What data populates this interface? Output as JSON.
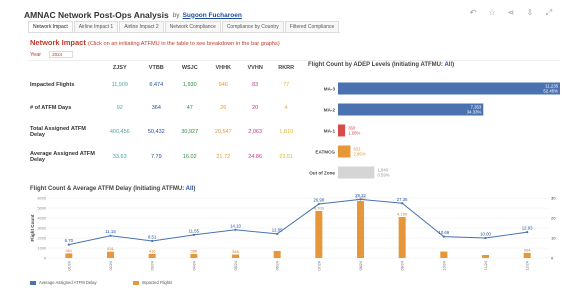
{
  "header": {
    "title": "AMNAC Network Post-Ops Analysis",
    "by": "by",
    "author": "Sugoon Fucharoen",
    "icons": [
      "undo-icon",
      "star-icon",
      "share-icon",
      "download-icon",
      "expand-icon"
    ]
  },
  "tabs": [
    "Network Impact",
    "Airline Impact 1",
    "Airline Impact 2",
    "Network Compliance",
    "Compliance by Country",
    "Filtered Compliance"
  ],
  "section": {
    "title": "Network Impact",
    "note": "(Click on an initiating ATFMU in the table to see breakdown in the bar graphs)",
    "year_label": "Year",
    "year_value": "2024"
  },
  "metrics_table": {
    "columns": [
      "ZJSY",
      "VTBB",
      "WSJC",
      "VHHK",
      "VVHN",
      "RKRR"
    ],
    "column_colors": [
      "#4fa3a5",
      "#1f4e9c",
      "#2e8b3e",
      "#e8963a",
      "#c0398b",
      "#e0b52a"
    ],
    "rows": [
      {
        "label": "Impacted Flights",
        "values": [
          "11,909",
          "6,474",
          "1,930",
          "946",
          "83",
          "77"
        ]
      },
      {
        "label": "# of ATFM Days",
        "values": [
          "92",
          "364",
          "47",
          "26",
          "20",
          "4"
        ]
      },
      {
        "label": "Total Assigned ATFM Delay",
        "values": [
          "400,456",
          "50,432",
          "30,927",
          "20,547",
          "2,063",
          "1,810"
        ]
      },
      {
        "label": "Average Assigned ATFM Delay",
        "values": [
          "33.63",
          "7.79",
          "16.02",
          "21.72",
          "24.86",
          "23.51"
        ]
      }
    ]
  },
  "adep_chart": {
    "title_prefix": "Flight Count by ADEP Levels (Initiating ATFMU:",
    "title_filter": "All",
    "title_suffix": ")",
    "chart_data": {
      "type": "bar",
      "categories": [
        "MA-3",
        "MA-2",
        "MA-1",
        "EATMCG",
        "Out of Zone"
      ],
      "values": [
        11235,
        7353,
        360,
        631,
        1840
      ],
      "value_labels": [
        "11,235",
        "7,353",
        "360",
        "631",
        "1,840"
      ],
      "percent_labels": [
        "52.45%",
        "34.33%",
        "1.68%",
        "2.95%",
        "8.59%"
      ],
      "colors": [
        "#4a72b0",
        "#4a72b0",
        "#d94b4b",
        "#e8963a",
        "#d5d5d5"
      ]
    }
  },
  "combo_chart": {
    "title_prefix": "Flight Count & Average ATFM Delay (Initiating ATFMU:",
    "title_filter": "All",
    "title_suffix": ")",
    "chart_data": {
      "type": "bar",
      "categories": [
        "01/24",
        "02/24",
        "03/24",
        "04/24",
        "05/24",
        "06/24",
        "07/24",
        "08/24",
        "09/24",
        "10/24",
        "11/24",
        "12/24"
      ],
      "x_labels": [
        "01/24",
        "02/24",
        "03/24",
        "04/24",
        "05/24",
        "06/24",
        "07/24",
        "08/24",
        "09/24",
        "10/24",
        "11/24",
        "12/24"
      ],
      "ylabel": "Flight Count",
      "ylim": [
        0,
        6000
      ],
      "yticks": [
        "0",
        "1000",
        "2000",
        "3000",
        "4000",
        "5000",
        "6000"
      ],
      "y2lim": [
        0,
        30
      ],
      "y2ticks": [
        "0",
        "10",
        "20",
        "30"
      ],
      "series": [
        {
          "name": "Impacted Flights",
          "color": "#e8963a",
          "kind": "bar",
          "values": [
            461,
            631,
            416,
            396,
            346,
            700,
            4700,
            5700,
            4100,
            640,
            300,
            504
          ],
          "value_labels": [
            "461",
            "631",
            "416",
            "396",
            "346",
            "",
            "4,700",
            "5,700",
            "4,100",
            "",
            "",
            "504"
          ]
        },
        {
          "name": "Average Assigned ATFM Delay",
          "color": "#4a72b0",
          "kind": "line",
          "values": [
            6.7,
            11.15,
            8.51,
            11.55,
            14.1,
            12.05,
            26.98,
            29.32,
            27.36,
            10.69,
            10.0,
            12.93
          ],
          "value_labels": [
            "6.70",
            "11.15",
            "8.51",
            "11.55",
            "14.10",
            "12.05",
            "26.98",
            "29.32",
            "27.36",
            "10.69",
            "10.00",
            "12.93"
          ]
        }
      ]
    }
  }
}
